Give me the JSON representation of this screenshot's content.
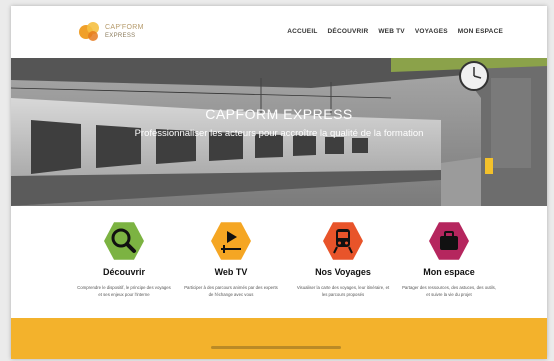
{
  "header": {
    "logo_line1": "CAP'FORM",
    "logo_line2": "EXPRESS",
    "nav": [
      "ACCUEIL",
      "DÉCOUVRIR",
      "WEB TV",
      "VOYAGES",
      "MON ESPACE"
    ]
  },
  "hero": {
    "title": "CAPFORM EXPRESS",
    "subtitle": "Professionnaliser les acteurs pour accroître la qualité de la formation"
  },
  "features": [
    {
      "title": "Découvrir",
      "icon": "magnifier-icon",
      "color": "#7cb342",
      "desc": "Comprendre le dispositif, le principe des voyages et ses enjeux pour l'interne"
    },
    {
      "title": "Web TV",
      "icon": "play-icon",
      "color": "#f5a623",
      "desc": "Participer à des parcours animés par des experts de l'échange avec vous"
    },
    {
      "title": "Nos Voyages",
      "icon": "train-icon",
      "color": "#e8542a",
      "desc": "Visualiser la carte des voyages, leur itinéraire, et les parcours proposés"
    },
    {
      "title": "Mon espace",
      "icon": "briefcase-icon",
      "color": "#b5265e",
      "desc": "Partager des ressources, des astuces, des outils, et suivre la vie du projet"
    }
  ],
  "colors": {
    "footer_band": "#f3b22c"
  }
}
